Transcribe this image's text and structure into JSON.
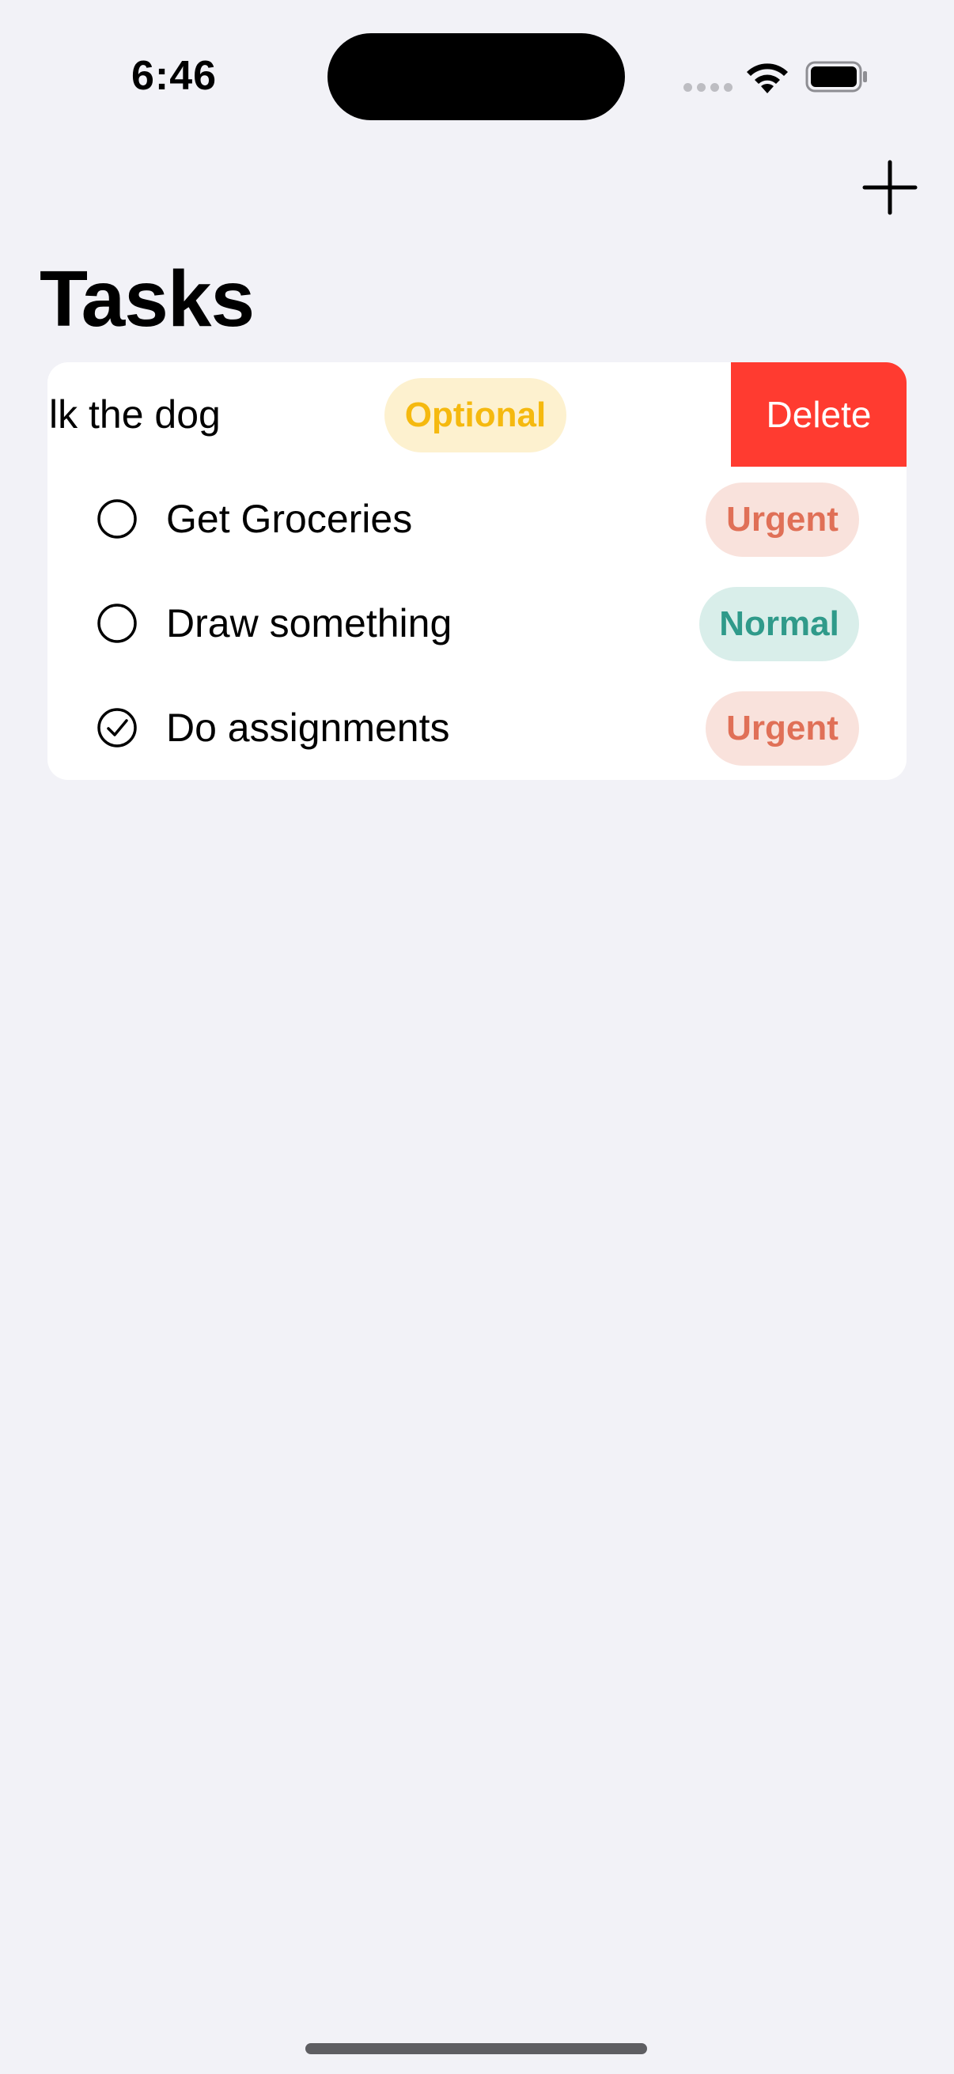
{
  "status_bar": {
    "time": "6:46"
  },
  "nav": {
    "add_icon": "plus-icon",
    "title": "Tasks"
  },
  "tasks": [
    {
      "label": "Walk the dog",
      "visible_label": "lk the dog",
      "priority": "Optional",
      "completed": false,
      "swiped": true
    },
    {
      "label": "Get Groceries",
      "priority": "Urgent",
      "completed": false
    },
    {
      "label": "Draw something",
      "priority": "Normal",
      "completed": false
    },
    {
      "label": "Do assignments",
      "priority": "Urgent",
      "completed": true
    }
  ],
  "swipe_actions": {
    "delete_label": "Delete"
  },
  "colors": {
    "background": "#F2F2F7",
    "delete": "#FF3B30",
    "urgent_text": "#E07057",
    "urgent_bg": "#F9E2DC",
    "normal_text": "#2F9A8A",
    "normal_bg": "#D9EEEA",
    "optional_text": "#F5B90F",
    "optional_bg": "#FDF1CF"
  }
}
